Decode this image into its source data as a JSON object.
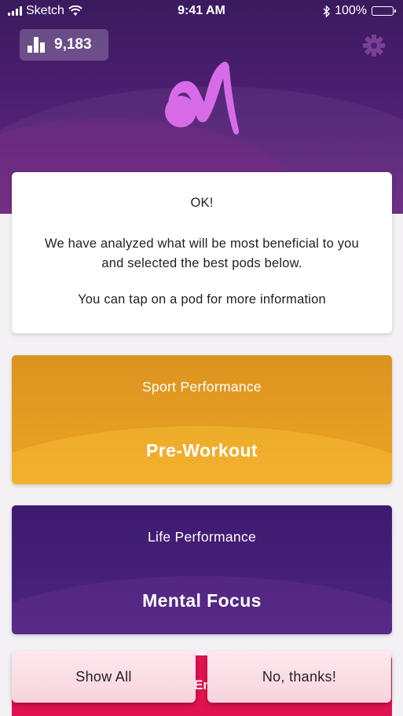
{
  "status_bar": {
    "carrier": "Sketch",
    "time": "9:41 AM",
    "battery": "100%"
  },
  "header": {
    "score": "9,183"
  },
  "message_card": {
    "title": "OK!",
    "message": "We have analyzed what will be most beneficial to you and selected the best pods below.",
    "hint": "You can tap on a pod for more information"
  },
  "pods": [
    {
      "category": "Sport Performance",
      "name": "Pre-Workout",
      "color": "#e39c22"
    },
    {
      "category": "Life Performance",
      "name": "Mental Focus",
      "color": "#46207a"
    }
  ],
  "partial_pod": {
    "visible_text": "En",
    "color": "#e0124f"
  },
  "buttons": {
    "show_all": "Show All",
    "no_thanks": "No, thanks!"
  },
  "icons": {
    "signal": "cellular-signal-icon",
    "wifi": "wifi-icon",
    "bluetooth": "bluetooth-icon",
    "battery": "battery-icon",
    "score": "bar-chart-icon",
    "settings": "gear-icon",
    "logo": "brand-logo"
  },
  "colors": {
    "header_purple": "#4c1f71",
    "logo_pink": "#d86ce8",
    "gear": "#7a3f96"
  }
}
